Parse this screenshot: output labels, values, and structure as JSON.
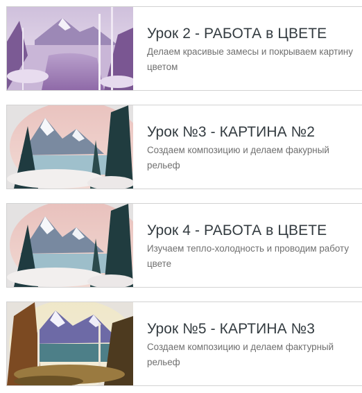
{
  "lessons": [
    {
      "title": "Урок 2 - РАБОТА в ЦВЕТЕ",
      "description": "Делаем красивые замесы и покрываем картину цветом",
      "thumbnail": "purple-winter-landscape-painting"
    },
    {
      "title": "Урок №3 - КАРТИНА №2",
      "description": "Создаем композицию и делаем факурный рельеф",
      "thumbnail": "pink-sky-snowy-mountain-painting"
    },
    {
      "title": "Урок 4 - РАБОТА в ЦВЕТЕ",
      "description": "Изучаем тепло-холодность и проводим работу цвете",
      "thumbnail": "pink-sky-snowy-mountain-painting"
    },
    {
      "title": "Урок №5 - КАРТИНА №3",
      "description": "Создаем композицию и делаем фактурный рельеф",
      "thumbnail": "autumn-lake-mountain-painting"
    }
  ]
}
